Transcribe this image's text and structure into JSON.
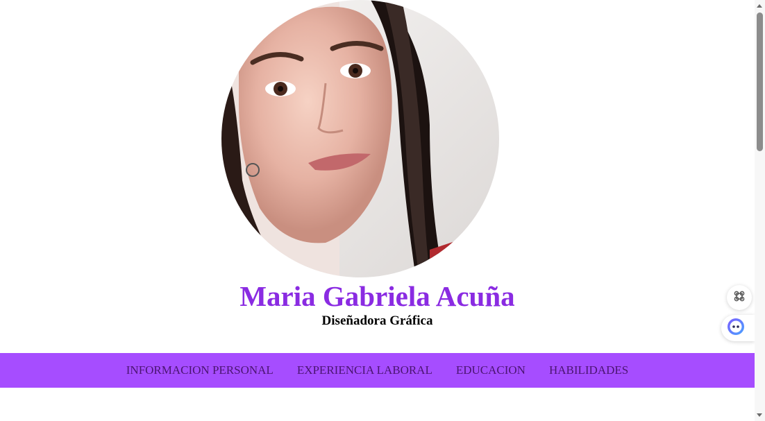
{
  "profile": {
    "name": "Maria Gabriela Acuña",
    "title": "Diseñadora Gráfica",
    "photo_alt": "profile-photo"
  },
  "nav": {
    "items": [
      {
        "label": "INFORMACION PERSONAL"
      },
      {
        "label": "EXPERIENCIA LABORAL"
      },
      {
        "label": "EDUCACION"
      },
      {
        "label": "HABILIDADES"
      }
    ]
  },
  "colors": {
    "name": "#8a2be2",
    "nav_background": "#a64dff",
    "nav_text": "#4a1470"
  },
  "widgets": {
    "top_icon": "command-icon",
    "bottom_icon": "assistant-face-icon"
  }
}
